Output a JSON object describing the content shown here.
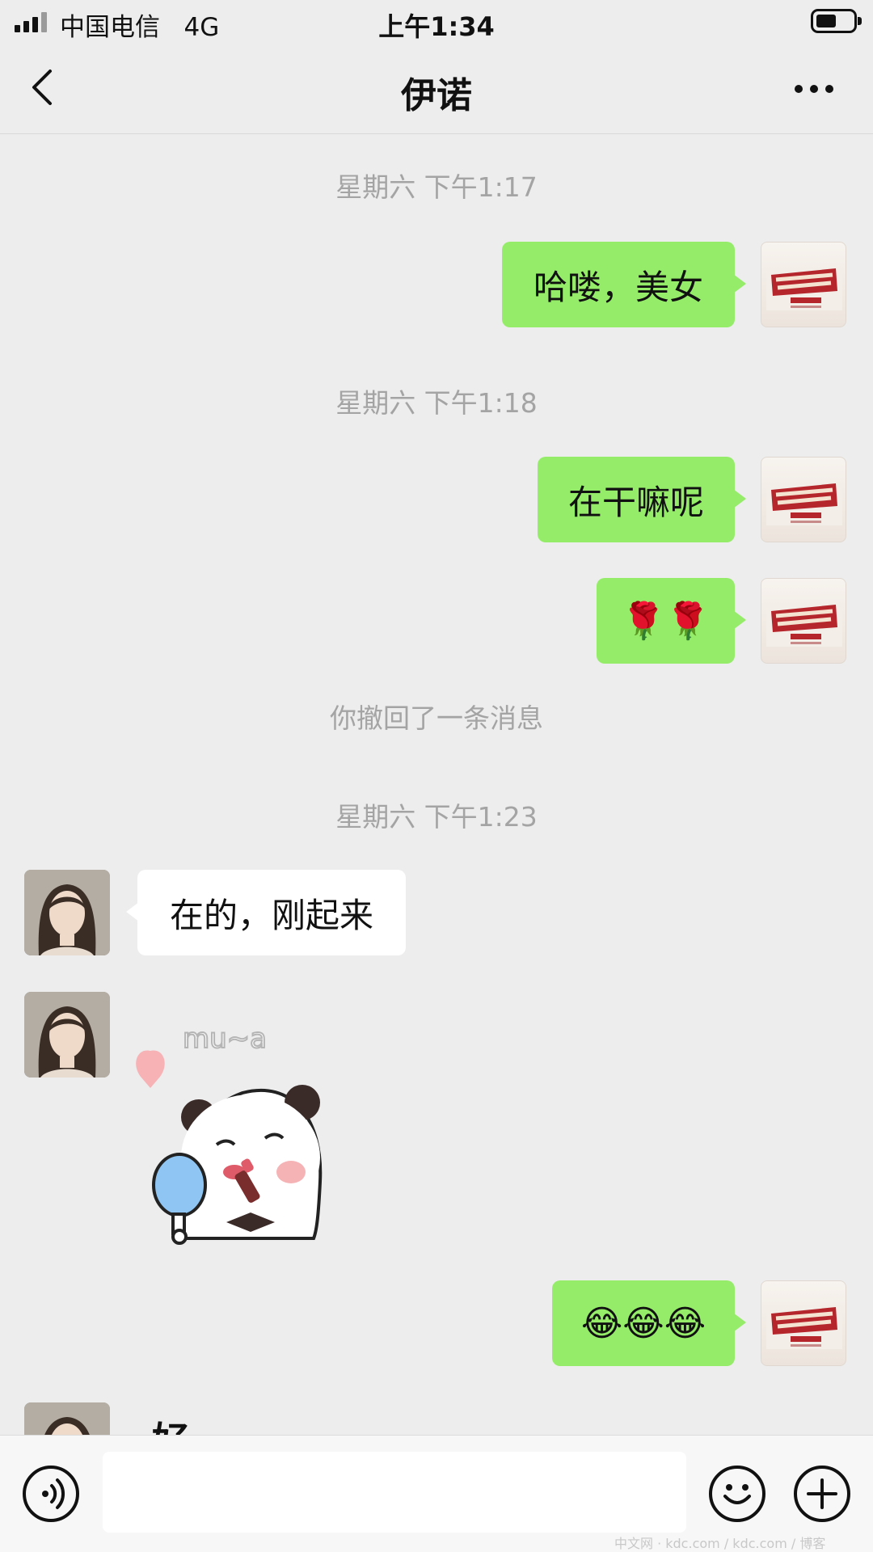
{
  "status_bar": {
    "carrier": "中国电信   4G",
    "time": "上午1:34"
  },
  "nav": {
    "title": "伊诺",
    "back_icon": "chevron-left-icon",
    "more_icon": "more-dots-icon"
  },
  "messages": {
    "ts1": "星期六 下午1:17",
    "msg1": "哈喽，美女",
    "ts2": "星期六 下午1:18",
    "msg2": "在干嘛呢",
    "msg3": "🌹🌹",
    "recall": "你撤回了一条消息",
    "ts3": "星期六 下午1:23",
    "msg4": "在的，刚起来",
    "sticker_text": "mu~a",
    "msg5": "😂😂😂",
    "msg6_partial": "好"
  },
  "input_bar": {
    "voice_icon": "voice-icon",
    "emoji_icon": "emoji-smile-icon",
    "plus_icon": "plus-icon",
    "placeholder": ""
  },
  "colors": {
    "background": "#ededed",
    "outgoing_bubble": "#95ec69",
    "incoming_bubble": "#ffffff",
    "timestamp": "#a4a4a4"
  },
  "watermark": "中文网 · kdc.com / kdc.com / 博客"
}
